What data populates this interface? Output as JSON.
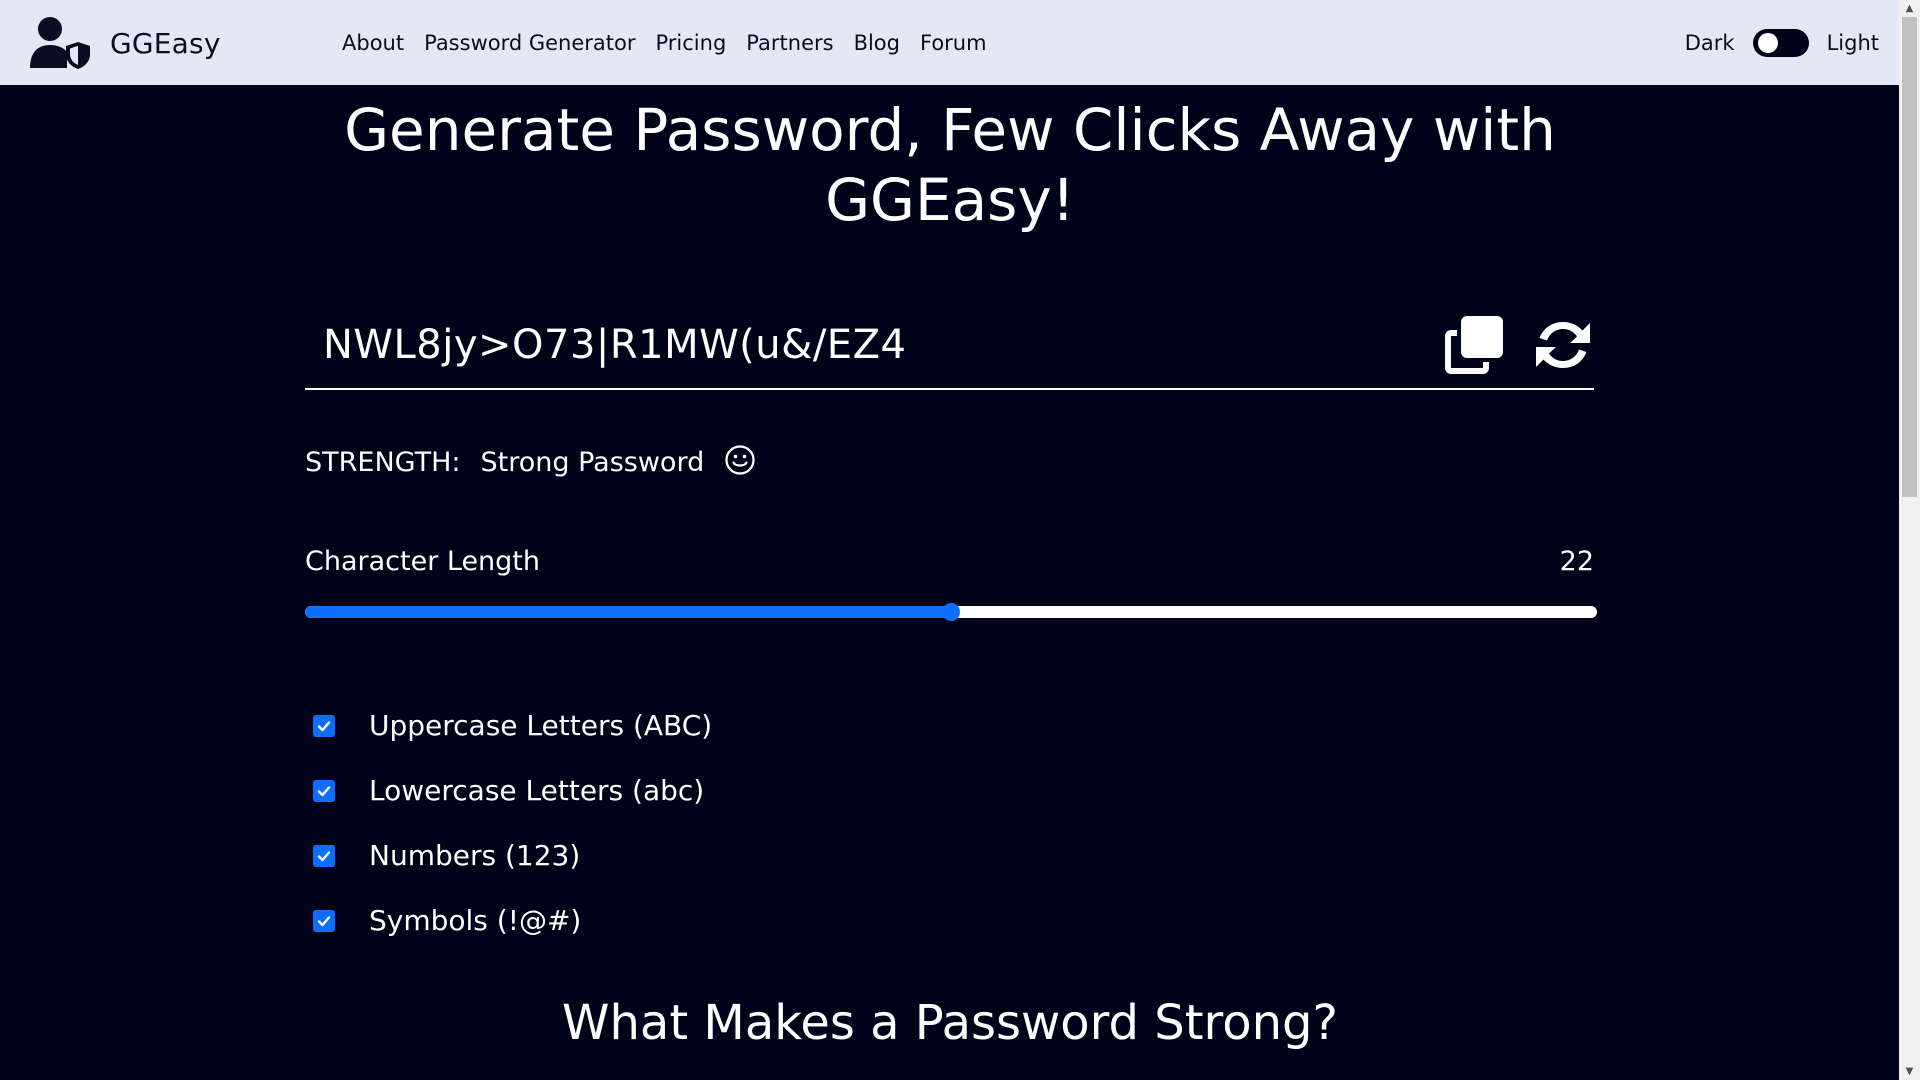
{
  "nav": {
    "brand": "GGEasy",
    "links": [
      "About",
      "Password Generator",
      "Pricing",
      "Partners",
      "Blog",
      "Forum"
    ],
    "theme_dark_label": "Dark",
    "theme_light_label": "Light"
  },
  "main": {
    "title": "Generate Password, Few Clicks Away with GGEasy!",
    "password": "NWL8jy>O73|R1MW(u&/EZ4",
    "strength_label": "STRENGTH:",
    "strength_value": "Strong Password",
    "length_label": "Character Length",
    "length_value": "22",
    "length_fraction": 0.5,
    "options": [
      {
        "label": "Uppercase Letters (ABC)",
        "checked": true
      },
      {
        "label": "Lowercase Letters (abc)",
        "checked": true
      },
      {
        "label": "Numbers (123)",
        "checked": true
      },
      {
        "label": "Symbols (!@#)",
        "checked": true
      }
    ],
    "section_title": "What Makes a Password Strong?"
  },
  "icons": {
    "brand": "user-shield-icon",
    "copy": "copy-icon",
    "refresh": "refresh-icon",
    "strength": "smiley-icon",
    "check": "checkmark-icon"
  },
  "colors": {
    "navbar_bg": "#e4e8f5",
    "page_bg": "#000219",
    "accent": "#0d6efd",
    "text_light": "#ffffff",
    "text_dark": "#0b0c22"
  }
}
